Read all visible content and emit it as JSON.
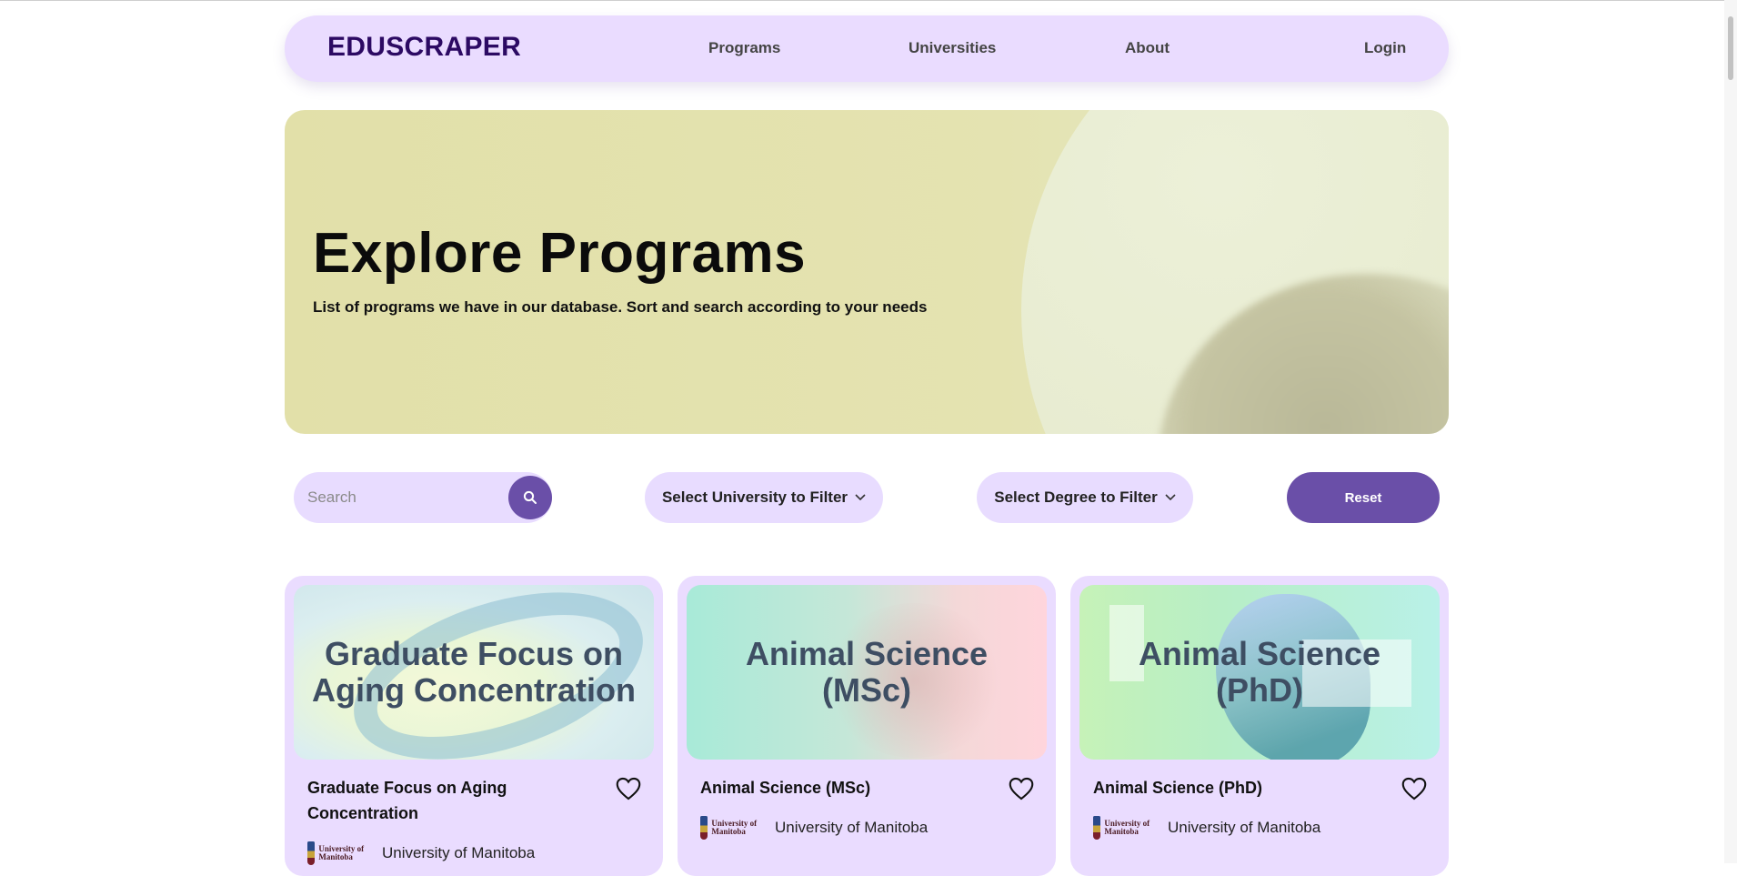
{
  "nav": {
    "brand": "EDUSCRAPER",
    "links": [
      "Programs",
      "Universities",
      "About"
    ],
    "login": "Login"
  },
  "hero": {
    "title": "Explore Programs",
    "subtitle": "List of programs we have in our database. Sort and search according to your needs"
  },
  "filters": {
    "search_placeholder": "Search",
    "university_select": "Select University to Filter",
    "degree_select": "Select Degree to Filter",
    "reset": "Reset"
  },
  "colors": {
    "accent": "#6a4fa8",
    "surface": "#eadcff",
    "brand": "#2c0a63"
  },
  "programs": [
    {
      "image_text": "Graduate Focus on Aging Concentration",
      "title": "Graduate Focus on Aging Concentration",
      "university": "University of Manitoba",
      "logo_text": "University of Manitoba"
    },
    {
      "image_text": "Animal Science (MSc)",
      "title": "Animal Science (MSc)",
      "university": "University of Manitoba",
      "logo_text": "University of Manitoba"
    },
    {
      "image_text": "Animal Science (PhD)",
      "title": "Animal Science (PhD)",
      "university": "University of Manitoba",
      "logo_text": "University of Manitoba"
    }
  ]
}
